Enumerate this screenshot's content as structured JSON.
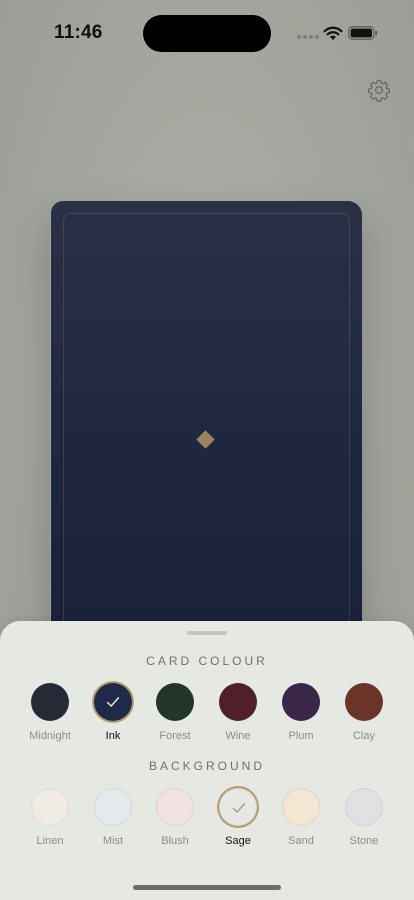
{
  "status_bar": {
    "time": "11:46"
  },
  "icons": {
    "settings": "gear-icon",
    "check": "check-icon"
  },
  "card": {
    "colour": "#222a42"
  },
  "sheet": {
    "card_colour": {
      "title": "CARD COLOUR",
      "selected": "Ink",
      "options": [
        {
          "label": "Midnight",
          "color": "#252a36"
        },
        {
          "label": "Ink",
          "color": "#1f2a4a"
        },
        {
          "label": "Forest",
          "color": "#223528"
        },
        {
          "label": "Wine",
          "color": "#4f1f2b"
        },
        {
          "label": "Plum",
          "color": "#3a2647"
        },
        {
          "label": "Clay",
          "color": "#6a3528"
        }
      ]
    },
    "background": {
      "title": "BACKGROUND",
      "selected": "Sage",
      "options": [
        {
          "label": "Linen",
          "color": "#f1ebe6"
        },
        {
          "label": "Mist",
          "color": "#e5e9ec"
        },
        {
          "label": "Blush",
          "color": "#f1e2e3"
        },
        {
          "label": "Sage",
          "color": "#e6e9e3"
        },
        {
          "label": "Sand",
          "color": "#f3e6d3"
        },
        {
          "label": "Stone",
          "color": "#e0e1e3"
        }
      ]
    }
  }
}
